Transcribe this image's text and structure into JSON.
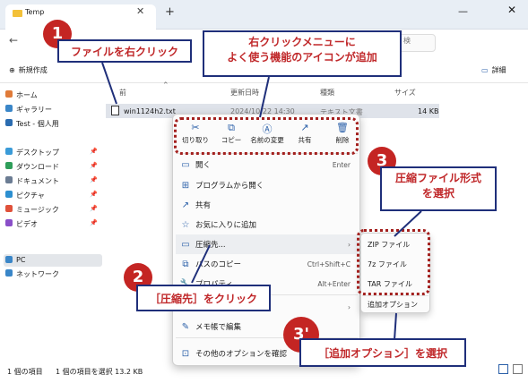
{
  "tab": {
    "title": "Temp",
    "close": "✕",
    "new": "+"
  },
  "window": {
    "minimize": "—",
    "close": "✕"
  },
  "nav": {
    "back": "←",
    "search_hint": "検"
  },
  "commandbar": {
    "new_label": "新規作成",
    "detail_label": "詳細"
  },
  "columns": {
    "name": "前",
    "date": "更新日時",
    "type": "種類",
    "size": "サイズ"
  },
  "file": {
    "name": "win1124h2.txt",
    "date": "2024/10/22 14:30",
    "type": "テキスト文書",
    "size": "14 KB"
  },
  "sidebar": [
    {
      "label": "ホーム",
      "icon": "home-icon",
      "color": "#e07b39"
    },
    {
      "label": "ギャラリー",
      "icon": "gallery-icon",
      "color": "#3a86c8"
    },
    {
      "label": "Test - 個人用",
      "icon": "cloud-icon",
      "color": "#2b6cb0"
    },
    {
      "label": "デスクトップ",
      "icon": "desktop-icon",
      "color": "#3a9bd8"
    },
    {
      "label": "ダウンロード",
      "icon": "download-icon",
      "color": "#2f9e5a"
    },
    {
      "label": "ドキュメント",
      "icon": "documents-icon",
      "color": "#6b7c93"
    },
    {
      "label": "ピクチャ",
      "icon": "pictures-icon",
      "color": "#2c8fd0"
    },
    {
      "label": "ミュージック",
      "icon": "music-icon",
      "color": "#e0513a"
    },
    {
      "label": "ビデオ",
      "icon": "videos-icon",
      "color": "#8a4fc8"
    },
    {
      "label": "PC",
      "icon": "pc-icon",
      "color": "#3a86c8"
    },
    {
      "label": "ネットワーク",
      "icon": "network-icon",
      "color": "#3a86c8"
    }
  ],
  "status": {
    "count": "1 個の項目",
    "selected": "1 個の項目を選択  13.2 KB"
  },
  "context_toolbar": [
    {
      "label": "切り取り",
      "glyph": "✂"
    },
    {
      "label": "コピー",
      "glyph": "⧉"
    },
    {
      "label": "名前の変更",
      "glyph": "Ⓐ"
    },
    {
      "label": "共有",
      "glyph": "↗"
    },
    {
      "label": "削除",
      "glyph": "🗑"
    }
  ],
  "context_menu": [
    {
      "label": "開く",
      "shortcut": "Enter",
      "glyph": "▭"
    },
    {
      "label": "プログラムから開く",
      "shortcut": "",
      "glyph": "⊞"
    },
    {
      "label": "共有",
      "shortcut": "",
      "glyph": "↗"
    },
    {
      "label": "お気に入りに追加",
      "shortcut": "",
      "glyph": "☆"
    },
    {
      "label": "圧縮先...",
      "shortcut": "›",
      "glyph": "▭"
    },
    {
      "label": "パスのコピー",
      "shortcut": "Ctrl+Shift+C",
      "glyph": "⧉"
    },
    {
      "label": "プロパティ",
      "shortcut": "Alt+Enter",
      "glyph": "🔧"
    },
    {
      "label": "",
      "shortcut": "›",
      "glyph": ""
    },
    {
      "label": "メモ帳で編集",
      "shortcut": "",
      "glyph": "✎"
    },
    {
      "label": "その他のオプションを確認",
      "shortcut": "",
      "glyph": "⊡"
    }
  ],
  "submenu": [
    "ZIP ファイル",
    "7z ファイル",
    "TAR ファイル",
    "追加オプション"
  ],
  "annotations": {
    "n1": "1",
    "c1": "ファイルを右クリック",
    "c_top_line1": "右クリックメニューに",
    "c_top_line2": "よく使う機能のアイコンが追加",
    "n2": "2",
    "c2": "［圧縮先］をクリック",
    "n3": "3",
    "c3_line1": "圧縮ファイル形式",
    "c3_line2": "を選択",
    "n3p": "3'",
    "c3p": "［追加オプション］を選択"
  }
}
